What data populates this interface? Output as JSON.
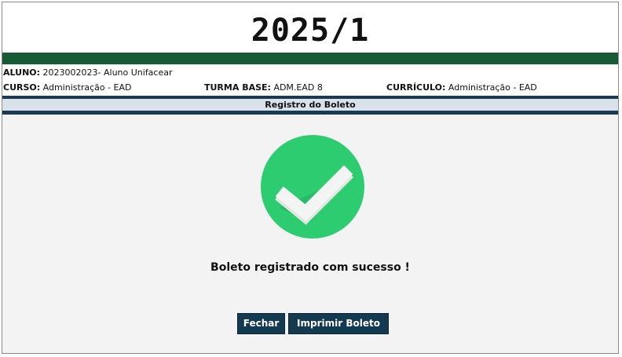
{
  "header": {
    "year": "2025/1"
  },
  "student": {
    "aluno_label": "ALUNO:",
    "aluno_value": "2023002023- Aluno Unifacear",
    "curso_label": "CURSO:",
    "curso_value": "Administração - EAD",
    "turma_label": "TURMA BASE:",
    "turma_value": "ADM.EAD 8",
    "curriculo_label": "CURRÍCULO:",
    "curriculo_value": "Administração - EAD"
  },
  "section": {
    "title": "Registro do Boleto"
  },
  "status": {
    "icon": "success-check-icon",
    "message": "Boleto registrado com sucesso !"
  },
  "actions": {
    "close_label": "Fechar",
    "print_label": "Imprimir Boleto"
  },
  "colors": {
    "green_bar": "#165a36",
    "section_line": "#1b3a52",
    "button_bg": "#143a52",
    "check_green": "#2ecc71"
  }
}
